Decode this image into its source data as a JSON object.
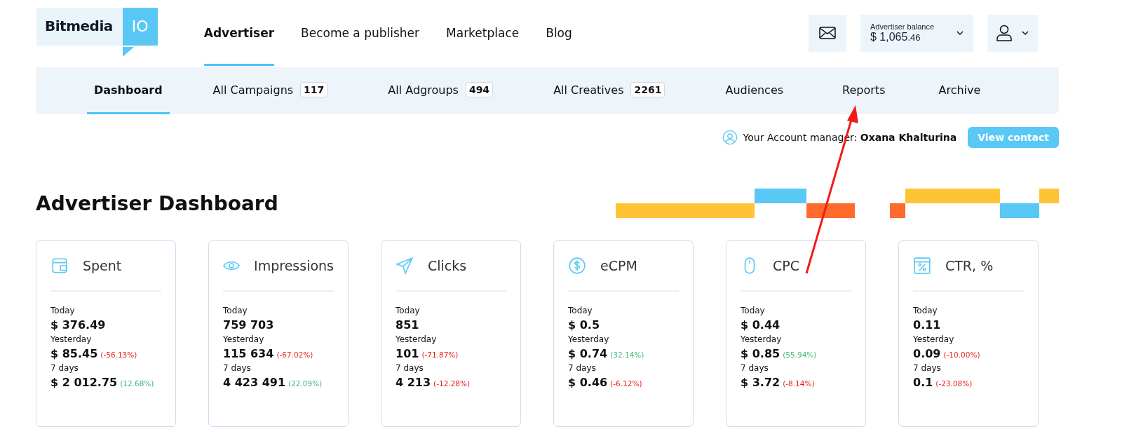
{
  "logo": {
    "name": "Bitmedia",
    "badge": "IO"
  },
  "main_nav": [
    {
      "label": "Advertiser",
      "selected": true
    },
    {
      "label": "Become a publisher",
      "selected": false
    },
    {
      "label": "Marketplace",
      "selected": false
    },
    {
      "label": "Blog",
      "selected": false
    }
  ],
  "balance": {
    "label": "Advertiser balance",
    "amount": "$ 1,065",
    "cents": ".46"
  },
  "sub_nav": [
    {
      "label": "Dashboard",
      "selected": true
    },
    {
      "label": "All Campaigns",
      "count": "117",
      "selected": false
    },
    {
      "label": "All Adgroups",
      "count": "494",
      "selected": false
    },
    {
      "label": "All Creatives",
      "count": "2261",
      "selected": false
    },
    {
      "label": "Audiences",
      "selected": false
    },
    {
      "label": "Reports",
      "selected": false
    },
    {
      "label": "Archive",
      "selected": false
    }
  ],
  "account_manager": {
    "label": "Your Account manager:",
    "name": "Oxana Khalturina",
    "button": "View contact"
  },
  "page_title": "Advertiser Dashboard",
  "cards": [
    {
      "kind": "wallet",
      "title": "Spent",
      "rows": [
        {
          "label": "Today",
          "value": "$ 376.49"
        },
        {
          "label": "Yesterday",
          "value": "$ 85.45",
          "change": "(-56.13%)",
          "color": "#ea1c1c"
        },
        {
          "label": "7 days",
          "value": "$ 2 012.75",
          "change": "(12.68%)",
          "color": "#3dbb7d"
        }
      ]
    },
    {
      "kind": "eye",
      "title": "Impressions",
      "rows": [
        {
          "label": "Today",
          "value": "759 703"
        },
        {
          "label": "Yesterday",
          "value": "115 634",
          "change": "(-67.02%)",
          "color": "#ea1c1c"
        },
        {
          "label": "7 days",
          "value": "4 423 491",
          "change": "(22.09%)",
          "color": "#3dbb7d"
        }
      ]
    },
    {
      "kind": "plane",
      "title": "Clicks",
      "rows": [
        {
          "label": "Today",
          "value": "851"
        },
        {
          "label": "Yesterday",
          "value": "101",
          "change": "(-71.87%)",
          "color": "#ea1c1c"
        },
        {
          "label": "7 days",
          "value": "4 213",
          "change": "(-12.28%)",
          "color": "#ea1c1c"
        }
      ]
    },
    {
      "kind": "coin",
      "title": "eCPM",
      "rows": [
        {
          "label": "Today",
          "value": "$ 0.5"
        },
        {
          "label": "Yesterday",
          "value": "$ 0.74",
          "change": "(32.14%)",
          "color": "#3dbb7d"
        },
        {
          "label": "7 days",
          "value": "$ 0.46",
          "change": "(-6.12%)",
          "color": "#ea1c1c"
        }
      ]
    },
    {
      "kind": "mouse",
      "title": "CPC",
      "rows": [
        {
          "label": "Today",
          "value": "$ 0.44"
        },
        {
          "label": "Yesterday",
          "value": "$ 0.85",
          "change": "(55.94%)",
          "color": "#3dbb7d"
        },
        {
          "label": "7 days",
          "value": "$ 3.72",
          "change": "(-8.14%)",
          "color": "#ea1c1c"
        }
      ]
    },
    {
      "kind": "percent",
      "title": "CTR, %",
      "rows": [
        {
          "label": "Today",
          "value": "0.11"
        },
        {
          "label": "Yesterday",
          "value": "0.09",
          "change": "(-10.00%)",
          "color": "#ea1c1c"
        },
        {
          "label": "7 days",
          "value": "0.1",
          "change": "(-23.08%)",
          "color": "#ea1c1c"
        }
      ]
    }
  ]
}
